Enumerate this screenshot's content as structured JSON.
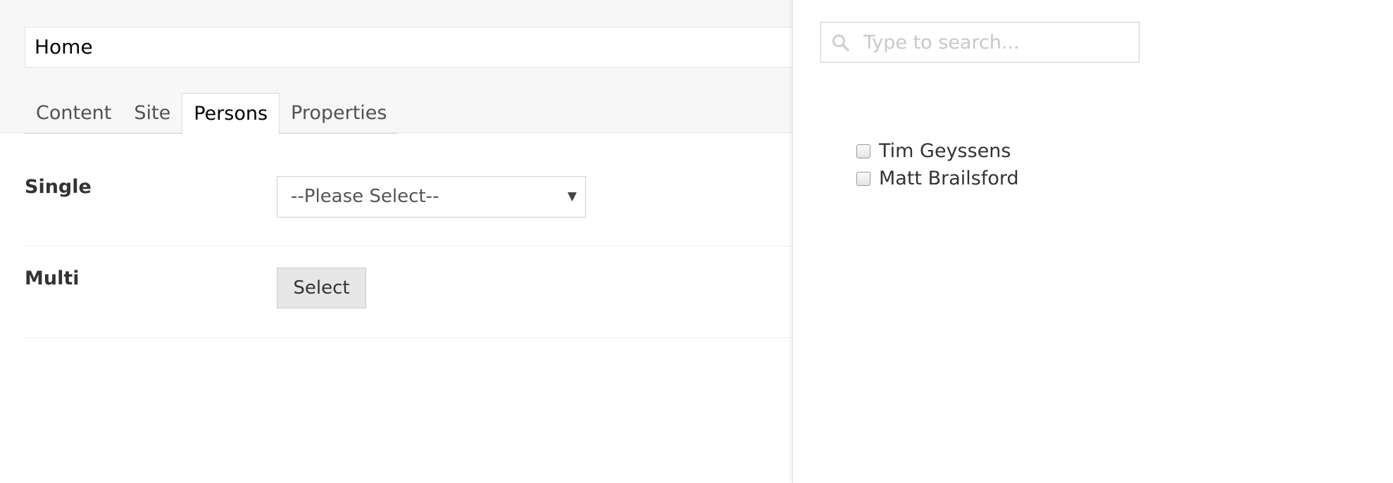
{
  "editor": {
    "name_value": "Home",
    "tabs": [
      {
        "label": "Content"
      },
      {
        "label": "Site"
      },
      {
        "label": "Persons"
      },
      {
        "label": "Properties"
      }
    ],
    "active_tab": "Persons",
    "properties": {
      "single": {
        "label": "Single",
        "selected": "--Please Select--",
        "arrow": "▼"
      },
      "multi": {
        "label": "Multi",
        "button_label": "Select"
      }
    }
  },
  "overlay": {
    "search": {
      "placeholder": "Type to search...",
      "value": "",
      "icon": "search-icon"
    },
    "persons": [
      {
        "name": "Tim Geyssens",
        "checked": false
      },
      {
        "name": "Matt Brailsford",
        "checked": false
      }
    ]
  }
}
